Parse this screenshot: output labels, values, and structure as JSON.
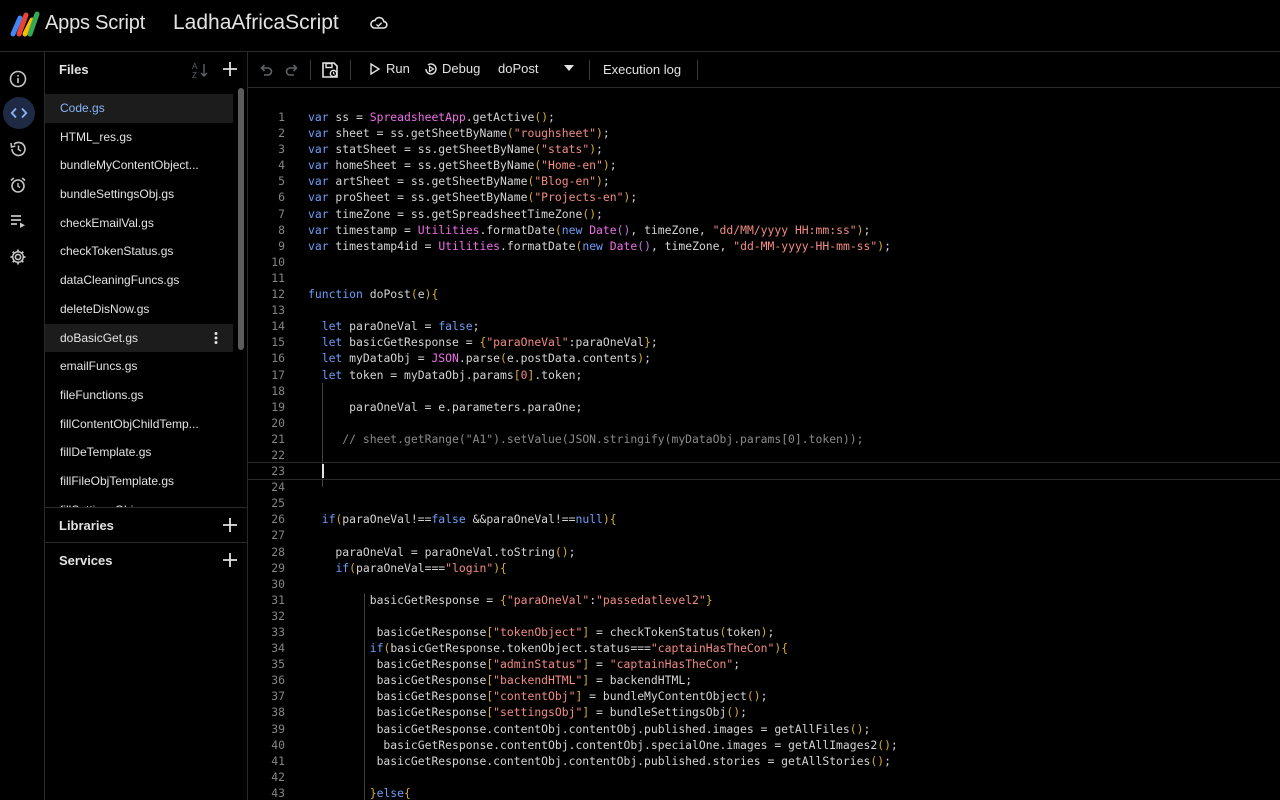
{
  "header": {
    "app_name": "Apps Script",
    "project_name": "LadhaAfricaScript"
  },
  "files": {
    "title": "Files",
    "items": [
      "Code.gs",
      "HTML_res.gs",
      "bundleMyContentObject...",
      "bundleSettingsObj.gs",
      "checkEmailVal.gs",
      "checkTokenStatus.gs",
      "dataCleaningFuncs.gs",
      "deleteDisNow.gs",
      "doBasicGet.gs",
      "emailFuncs.gs",
      "fileFunctions.gs",
      "fillContentObjChildTemp...",
      "fillDeTemplate.gs",
      "fillFileObjTemplate.gs",
      "fillSettingsObj.gs"
    ]
  },
  "sections": {
    "libraries": "Libraries",
    "services": "Services"
  },
  "toolbar": {
    "run": "Run",
    "debug": "Debug",
    "function_name": "doPost",
    "execution_log": "Execution log"
  },
  "editor": {
    "current_line": 23,
    "line_numbers": [
      "1",
      "2",
      "3",
      "4",
      "5",
      "6",
      "7",
      "8",
      "9",
      "10",
      "11",
      "12",
      "13",
      "14",
      "15",
      "16",
      "17",
      "18",
      "19",
      "20",
      "21",
      "22",
      "23",
      "24",
      "25",
      "26",
      "27",
      "28",
      "29",
      "30",
      "31",
      "32",
      "33",
      "34",
      "35",
      "36",
      "37",
      "38",
      "39",
      "40",
      "41",
      "42",
      "43"
    ],
    "lines": [
      "var ss = SpreadsheetApp.getActive();",
      "var sheet = ss.getSheetByName(\"roughsheet\");",
      "var statSheet = ss.getSheetByName(\"stats\");",
      "var homeSheet = ss.getSheetByName(\"Home-en\");",
      "var artSheet = ss.getSheetByName(\"Blog-en\");",
      "var proSheet = ss.getSheetByName(\"Projects-en\");",
      "var timeZone = ss.getSpreadsheetTimeZone();",
      "var timestamp = Utilities.formatDate(new Date(), timeZone, \"dd/MM/yyyy HH:mm:ss\");",
      "var timestamp4id = Utilities.formatDate(new Date(), timeZone, \"dd-MM-yyyy-HH-mm-ss\");",
      "",
      "",
      "function doPost(e){",
      "",
      "  let paraOneVal = false;",
      "  let basicGetResponse = {\"paraOneVal\":paraOneVal};",
      "  let myDataObj = JSON.parse(e.postData.contents);",
      "  let token = myDataObj.params[0].token;",
      "",
      "      paraOneVal = e.parameters.paraOne;",
      "",
      "     // sheet.getRange(\"A1\").setValue(JSON.stringify(myDataObj.params[0].token));",
      "",
      "",
      "",
      "",
      "  if(paraOneVal!==false &&paraOneVal!==null){",
      "",
      "    paraOneVal = paraOneVal.toString();",
      "    if(paraOneVal===\"login\"){",
      "",
      "         basicGetResponse = {\"paraOneVal\":\"passedatlevel2\"}",
      "",
      "          basicGetResponse[\"tokenObject\"] = checkTokenStatus(token);",
      "         if(basicGetResponse.tokenObject.status===\"captainHasTheCon\"){",
      "          basicGetResponse[\"adminStatus\"] = \"captainHasTheCon\";",
      "          basicGetResponse[\"backendHTML\"] = backendHTML;",
      "          basicGetResponse[\"contentObj\"] = bundleMyContentObject();",
      "          basicGetResponse[\"settingsObj\"] = bundleSettingsObj();",
      "          basicGetResponse.contentObj.contentObj.published.images = getAllFiles();",
      "           basicGetResponse.contentObj.contentObj.specialOne.images = getAllImages2();",
      "          basicGetResponse.contentObj.contentObj.published.stories = getAllStories();",
      "",
      "         }else{"
    ]
  }
}
